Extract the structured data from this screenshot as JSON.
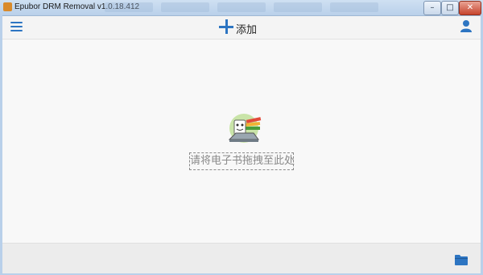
{
  "window": {
    "title": "Epubor DRM Removal v1.0.18.412",
    "minimize_glyph": "–",
    "maximize_glyph": "□",
    "close_glyph": "✕"
  },
  "toolbar": {
    "menu_icon": "hamburger-menu-icon",
    "add_icon": "plus-icon",
    "add_label": "添加",
    "user_icon": "user-icon"
  },
  "main": {
    "drop_hint": "请将电子书拖拽至此处",
    "drop_art_icon": "books-laptop-illustration"
  },
  "footer": {
    "folder_icon": "folder-icon"
  },
  "colors": {
    "accent": "#2d75c2",
    "toolbar_bg": "#f4f4f4",
    "main_bg": "#f8f8f8",
    "footer_bg": "#ececec"
  }
}
